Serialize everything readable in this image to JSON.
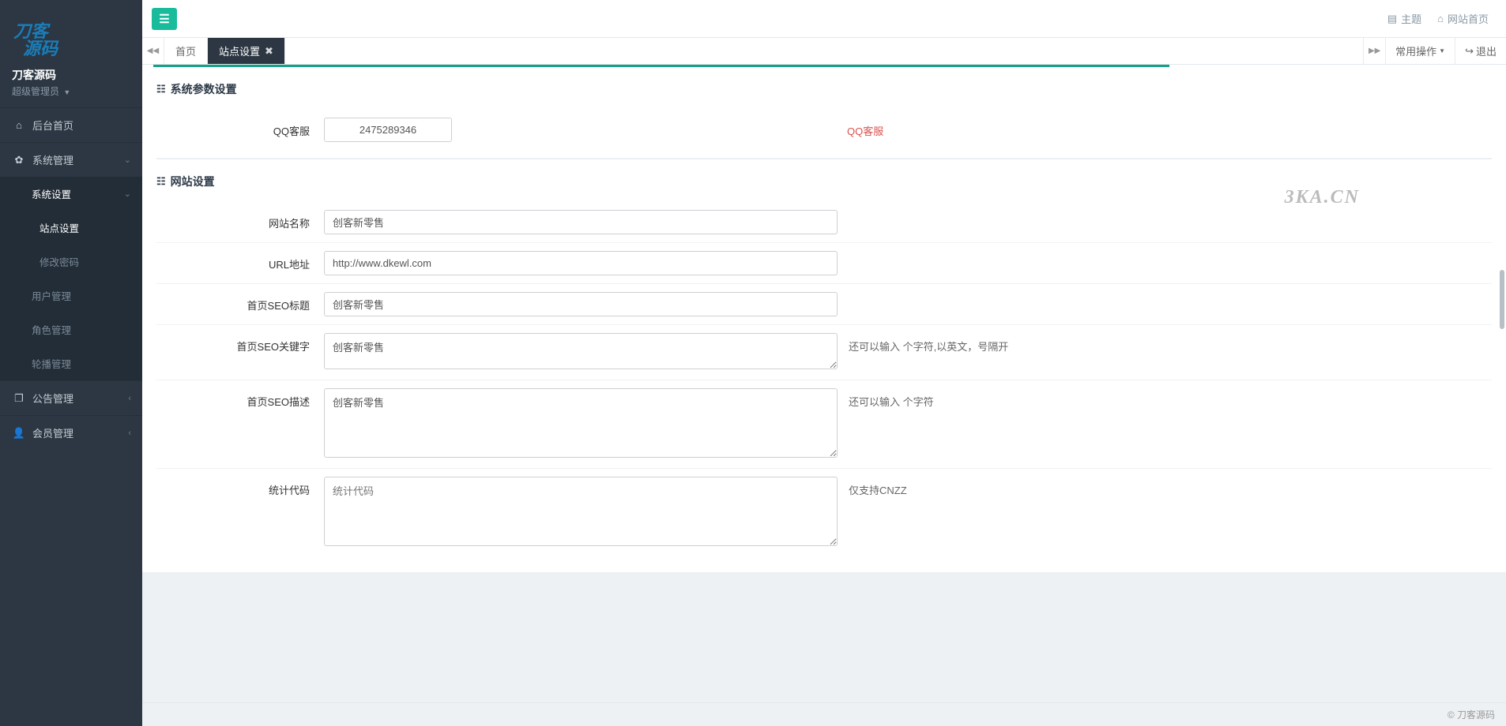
{
  "brand": "刀客源码",
  "role": "超级管理员",
  "sidebar": {
    "home": "后台首页",
    "system": "系统管理",
    "system_settings": "系统设置",
    "site_settings": "站点设置",
    "change_password": "修改密码",
    "user_management": "用户管理",
    "role_management": "角色管理",
    "carousel_management": "轮播管理",
    "announcement": "公告管理",
    "member": "会员管理"
  },
  "topbar": {
    "theme": "主题",
    "site_home": "网站首页"
  },
  "tabs": {
    "home": "首页",
    "site_settings": "站点设置",
    "common_ops": "常用操作",
    "logout": "退出"
  },
  "section1_title": "系统参数设置",
  "section2_title": "网站设置",
  "fields": {
    "qq_label": "QQ客服",
    "qq_value": "2475289346",
    "qq_help": "QQ客服",
    "site_name_label": "网站名称",
    "site_name_value": "创客新零售",
    "url_label": "URL地址",
    "url_value": "http://www.dkewl.com",
    "seo_title_label": "首页SEO标题",
    "seo_title_value": "创客新零售",
    "seo_keywords_label": "首页SEO关键字",
    "seo_keywords_value": "创客新零售",
    "seo_keywords_help": "还可以输入 个字符,以英文，号隔开",
    "seo_desc_label": "首页SEO描述",
    "seo_desc_value": "创客新零售",
    "seo_desc_help": "还可以输入 个字符",
    "stats_label": "统计代码",
    "stats_placeholder": "统计代码",
    "stats_help": "仅支持CNZZ"
  },
  "watermark": "3KA.CN",
  "footer": "© 刀客源码"
}
